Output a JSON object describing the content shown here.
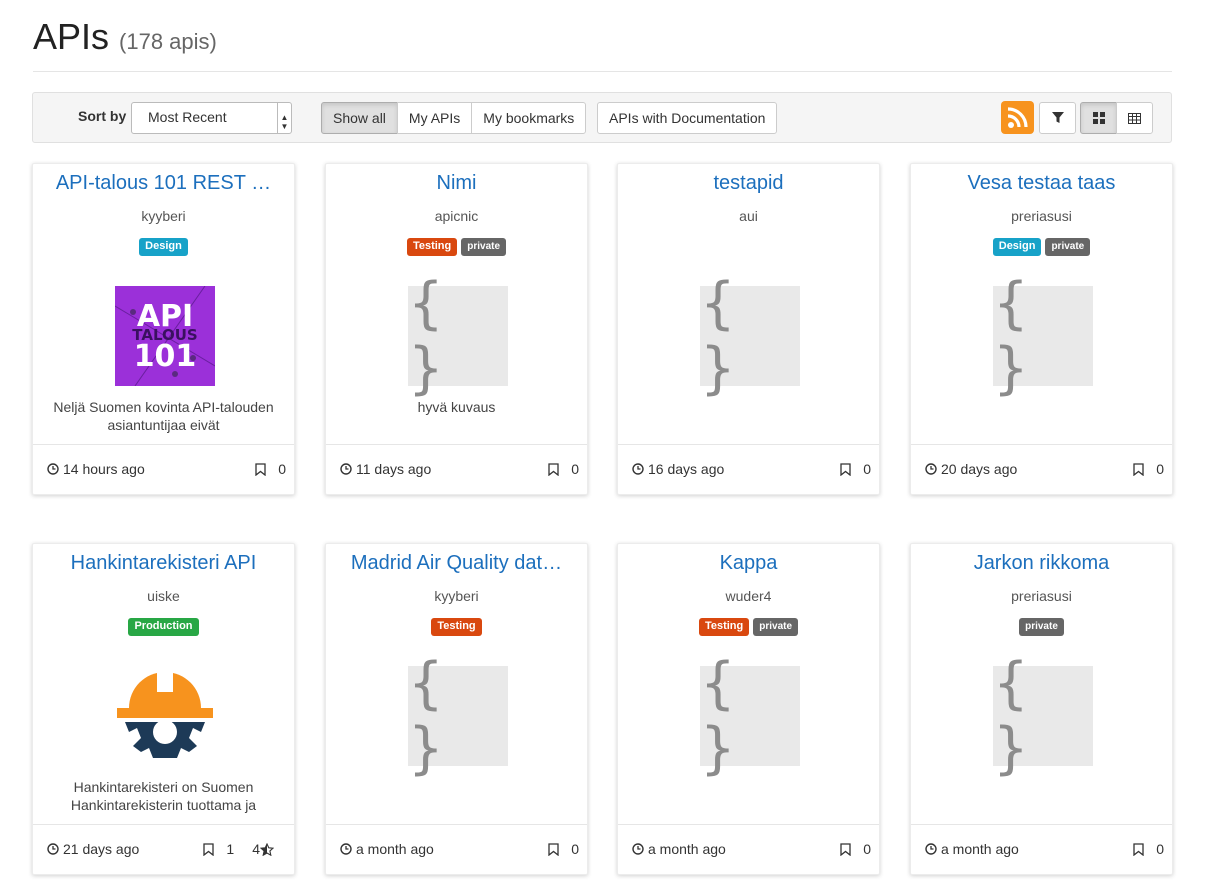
{
  "header": {
    "title": "APIs",
    "count": "(178 apis)"
  },
  "toolbar": {
    "sort_label": "Sort by",
    "sort_value": "Most Recent",
    "filters": [
      "Show all",
      "My APIs",
      "My bookmarks"
    ],
    "docs_filter": "APIs with Documentation",
    "rss_color": "#f7931e"
  },
  "cards": [
    {
      "title": "API-talous 101 REST …",
      "owner": "kyyberi",
      "tags": [
        "Design"
      ],
      "image": "api-talous-logo",
      "desc": "Neljä Suomen kovinta API-talouden asiantuntijaa eivät",
      "time": "14 hours ago",
      "bookmarks": "0"
    },
    {
      "title": "Nimi",
      "owner": "apicnic",
      "tags": [
        "Testing",
        "private"
      ],
      "image": "placeholder",
      "desc": "hyvä kuvaus",
      "time": "11 days ago",
      "bookmarks": "0"
    },
    {
      "title": "testapid",
      "owner": "aui",
      "tags": [],
      "image": "placeholder",
      "desc": "",
      "time": "16 days ago",
      "bookmarks": "0"
    },
    {
      "title": "Vesa testaa taas",
      "owner": "preriasusi",
      "tags": [
        "Design",
        "private"
      ],
      "image": "placeholder",
      "desc": "",
      "time": "20 days ago",
      "bookmarks": "0"
    },
    {
      "title": "Hankintarekisteri API",
      "owner": "uiske",
      "tags": [
        "Production"
      ],
      "image": "hardhat-gear-logo",
      "desc": "Hankintarekisteri on Suomen Hankintarekisterin tuottama ja",
      "time": "21 days ago",
      "bookmarks": "1",
      "stars": "4"
    },
    {
      "title": "Madrid Air Quality dat…",
      "owner": "kyyberi",
      "tags": [
        "Testing"
      ],
      "image": "placeholder",
      "desc": "",
      "time": "a month ago",
      "bookmarks": "0"
    },
    {
      "title": "Kappa",
      "owner": "wuder4",
      "tags": [
        "Testing",
        "private"
      ],
      "image": "placeholder",
      "desc": "",
      "time": "a month ago",
      "bookmarks": "0"
    },
    {
      "title": "Jarkon rikkoma",
      "owner": "preriasusi",
      "tags": [
        "private"
      ],
      "image": "placeholder",
      "desc": "",
      "time": "a month ago",
      "bookmarks": "0"
    }
  ],
  "placeholder_glyph": "{ }"
}
